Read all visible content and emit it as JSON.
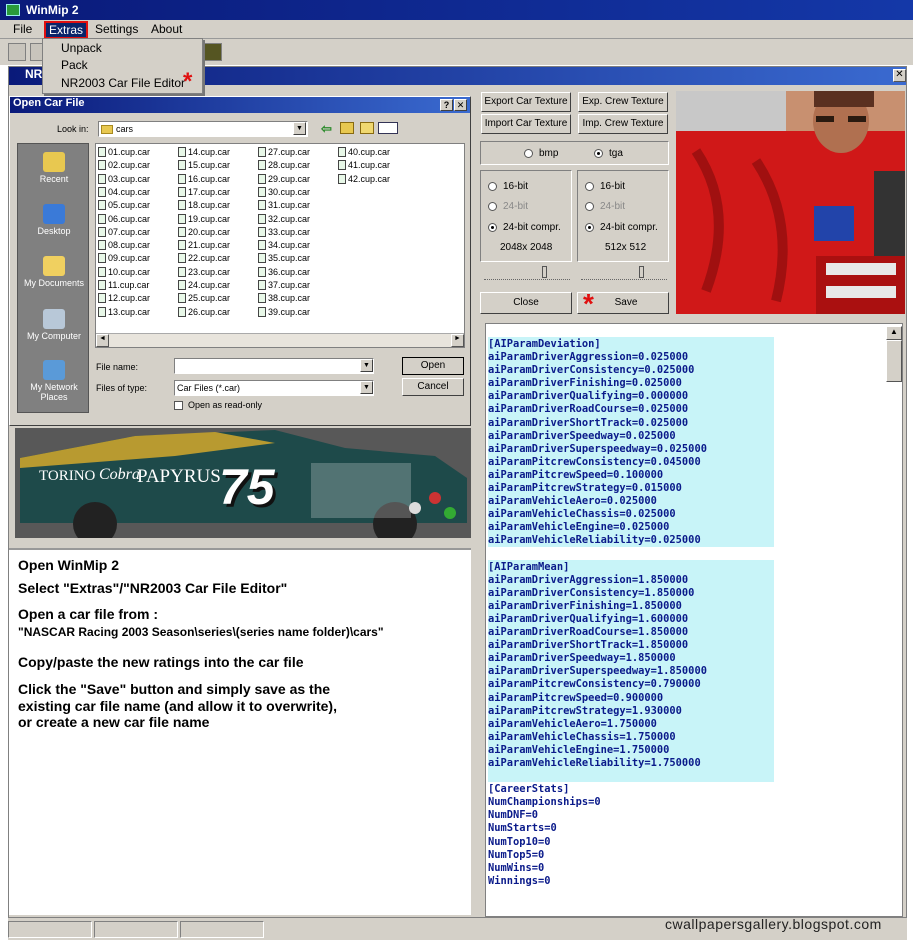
{
  "app": {
    "title": "WinMip 2"
  },
  "menu": {
    "file": "File",
    "extras": "Extras",
    "settings": "Settings",
    "about": "About"
  },
  "extras_menu": {
    "items": [
      "Unpack",
      "Pack",
      "NR2003 Car File Editor"
    ]
  },
  "mdi": {
    "title": "NR"
  },
  "texture_buttons": {
    "export_car": "Export Car Texture",
    "export_crew": "Exp. Crew Texture",
    "import_car": "Import Car Texture",
    "import_crew": "Imp. Crew Texture"
  },
  "format": {
    "bmp": "bmp",
    "tga": "tga",
    "selected": "tga"
  },
  "car_bits": {
    "opt16": "16-bit",
    "opt24": "24-bit",
    "opt24c": "24-bit compr.",
    "size": "2048x 2048"
  },
  "crew_bits": {
    "opt16": "16-bit",
    "opt24": "24-bit",
    "opt24c": "24-bit compr.",
    "size": "512x 512"
  },
  "actions": {
    "close": "Close",
    "save": "Save"
  },
  "dialog": {
    "title": "Open Car File",
    "help": "?",
    "look_in_label": "Look in:",
    "look_in_value": "cars",
    "places": [
      "Recent",
      "Desktop",
      "My Documents",
      "My Computer",
      "My Network Places"
    ],
    "files": [
      "01.cup.car",
      "02.cup.car",
      "03.cup.car",
      "04.cup.car",
      "05.cup.car",
      "06.cup.car",
      "07.cup.car",
      "08.cup.car",
      "09.cup.car",
      "10.cup.car",
      "11.cup.car",
      "12.cup.car",
      "13.cup.car",
      "14.cup.car",
      "15.cup.car",
      "16.cup.car",
      "17.cup.car",
      "18.cup.car",
      "19.cup.car",
      "20.cup.car",
      "21.cup.car",
      "22.cup.car",
      "23.cup.car",
      "24.cup.car",
      "25.cup.car",
      "26.cup.car",
      "27.cup.car",
      "28.cup.car",
      "29.cup.car",
      "30.cup.car",
      "31.cup.car",
      "32.cup.car",
      "33.cup.car",
      "34.cup.car",
      "35.cup.car",
      "36.cup.car",
      "37.cup.car",
      "38.cup.car",
      "39.cup.car",
      "40.cup.car",
      "41.cup.car",
      "42.cup.car"
    ],
    "file_name_label": "File name:",
    "file_name_value": "",
    "file_type_label": "Files of type:",
    "file_type_value": "Car Files (*.car)",
    "open": "Open",
    "cancel": "Cancel",
    "readonly": "Open as read-only"
  },
  "car": {
    "text1": "TORINO",
    "text2": "Cobra",
    "text3": "PAPYRUS",
    "number": "75"
  },
  "instructions": [
    "Open WinMip 2",
    "Select \"Extras\"/\"NR2003 Car File Editor\"",
    "Open a car file from :",
    "\"NASCAR Racing 2003 Season\\series\\(series name folder)\\cars\"",
    "Copy/paste the new ratings into the car file",
    "Click the \"Save\" button and simply save as the",
    " existing car file name (and allow it to overwrite),",
    "  or create a new car file name"
  ],
  "editor_lines": [
    "[AIParamDeviation]",
    "aiParamDriverAggression=0.025000",
    "aiParamDriverConsistency=0.025000",
    "aiParamDriverFinishing=0.025000",
    "aiParamDriverQualifying=0.000000",
    "aiParamDriverRoadCourse=0.025000",
    "aiParamDriverShortTrack=0.025000",
    "aiParamDriverSpeedway=0.025000",
    "aiParamDriverSuperspeedway=0.025000",
    "aiParamPitcrewConsistency=0.045000",
    "aiParamPitcrewSpeed=0.100000",
    "aiParamPitcrewStrategy=0.015000",
    "aiParamVehicleAero=0.025000",
    "aiParamVehicleChassis=0.025000",
    "aiParamVehicleEngine=0.025000",
    "aiParamVehicleReliability=0.025000",
    "",
    "[AIParamMean]",
    "aiParamDriverAggression=1.850000",
    "aiParamDriverConsistency=1.850000",
    "aiParamDriverFinishing=1.850000",
    "aiParamDriverQualifying=1.600000",
    "aiParamDriverRoadCourse=1.850000",
    "aiParamDriverShortTrack=1.850000",
    "aiParamDriverSpeedway=1.850000",
    "aiParamDriverSuperspeedway=1.850000",
    "aiParamPitcrewConsistency=0.790000",
    "aiParamPitcrewSpeed=0.900000",
    "aiParamPitcrewStrategy=1.930000",
    "aiParamVehicleAero=1.750000",
    "aiParamVehicleChassis=1.750000",
    "aiParamVehicleEngine=1.750000",
    "aiParamVehicleReliability=1.750000",
    "",
    "[CareerStats]",
    "NumChampionships=0",
    "NumDNF=0",
    "NumStarts=0",
    "NumTop10=0",
    "NumTop5=0",
    "NumWins=0",
    "Winnings=0"
  ],
  "watermark": "cwallpapersgallery.blogspot.com",
  "colors": {
    "title_bar": "#0a1a7a",
    "highlight": "#c8f4f8",
    "code_text": "#0a1a8a",
    "star": "#e01010"
  }
}
